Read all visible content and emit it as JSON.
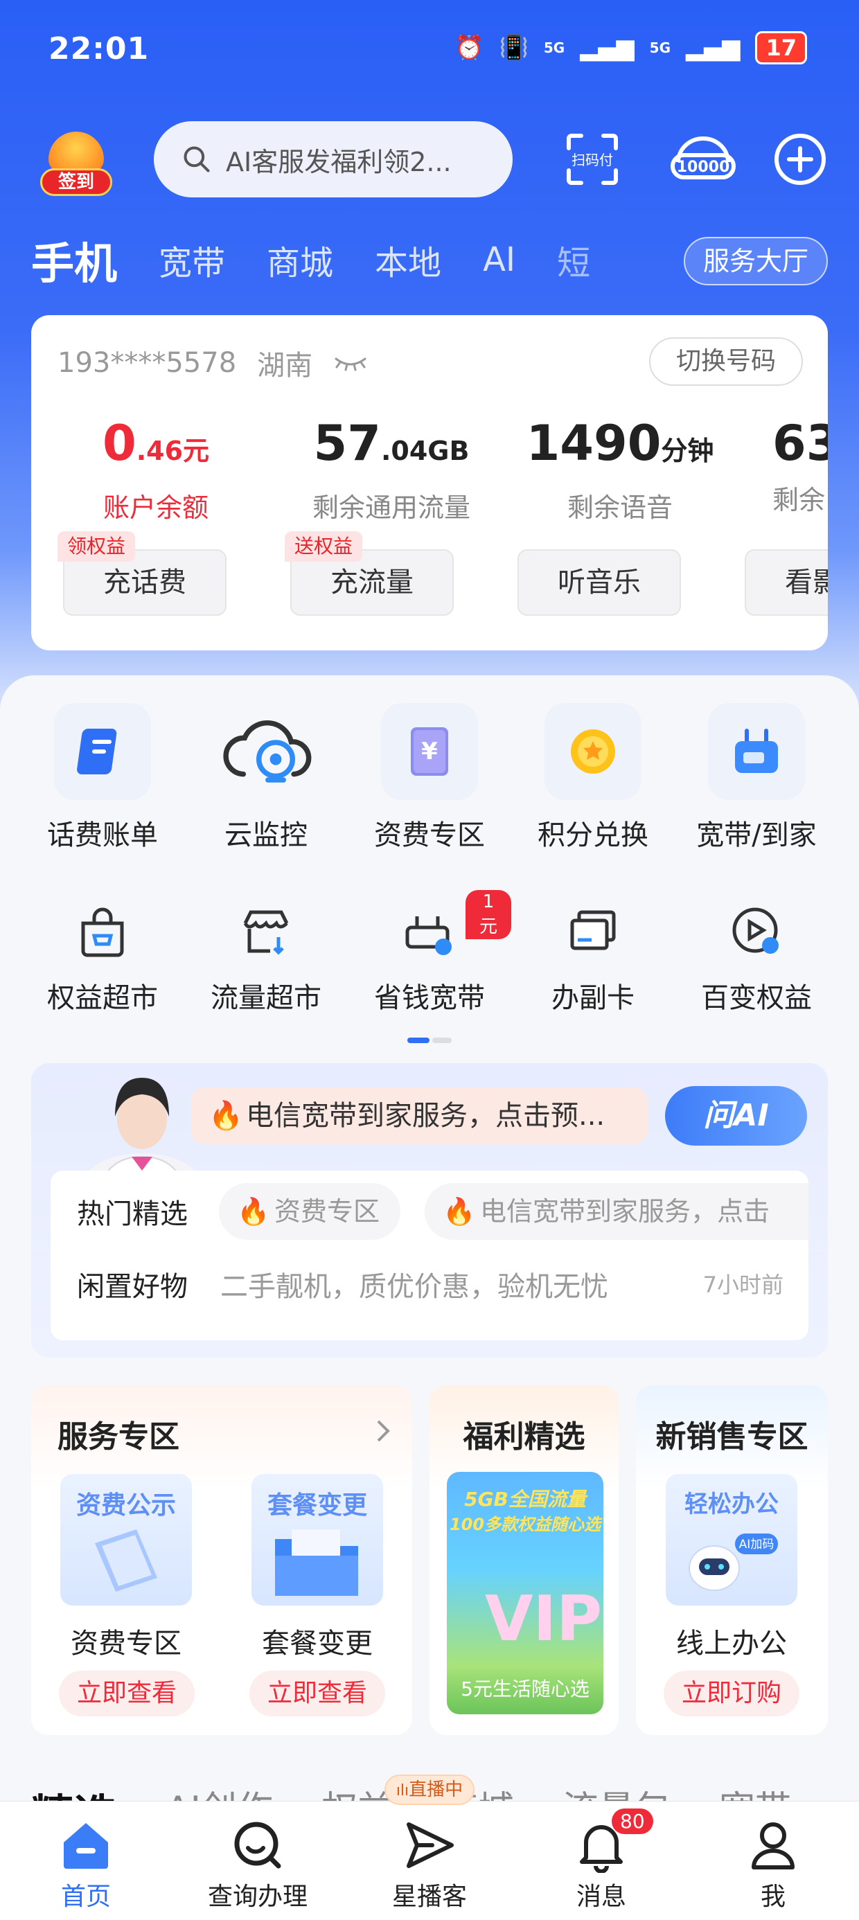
{
  "status_bar": {
    "time": "22:01",
    "battery": "17",
    "signal1": "5G",
    "signal2": "5G"
  },
  "top": {
    "signin_label": "签到",
    "search_placeholder": "AI客服发福利领2...",
    "scan_label": "扫码付",
    "hotline_label": "10000"
  },
  "tabs": [
    "手机",
    "宽带",
    "商城",
    "本地",
    "AI",
    "短"
  ],
  "service_hall": "服务大厅",
  "account": {
    "number": "193****5578",
    "region": "湖南",
    "switch_label": "切换号码",
    "stats": [
      {
        "big": "0.",
        "small": ".46元",
        "bigtext": "0",
        "label": "账户余额"
      },
      {
        "bigtext": "57",
        "small": ".04GB",
        "label": "剩余通用流量"
      },
      {
        "bigtext": "1490",
        "small": "分钟",
        "label": "剩余语音"
      },
      {
        "bigtext": "63",
        "small": "",
        "label": "剩余"
      }
    ],
    "actions": [
      "充话费",
      "充流量",
      "听音乐",
      "看影"
    ],
    "tags": [
      "领权益",
      "送权益"
    ]
  },
  "grid": [
    {
      "label": "话费账单"
    },
    {
      "label": "云监控"
    },
    {
      "label": "资费专区"
    },
    {
      "label": "积分兑换"
    },
    {
      "label": "宽带/到家"
    },
    {
      "label": "权益超市"
    },
    {
      "label": "流量超市"
    },
    {
      "label": "省钱宽带",
      "badge": "1元"
    },
    {
      "label": "办副卡"
    },
    {
      "label": "百变权益"
    }
  ],
  "ai": {
    "bubble": "电信宽带到家服务，点击预...",
    "ask_ai": "问AI",
    "hot_label": "热门精选",
    "chips": [
      "资费专区",
      "电信宽带到家服务，点击"
    ],
    "idle_label": "闲置好物",
    "idle_text": "二手靓机，质优价惠，验机无忧",
    "idle_time": "7小时前"
  },
  "service_zone": {
    "title": "服务专区",
    "items": [
      {
        "pic_title": "资费公示",
        "label": "资费专区",
        "button": "立即查看"
      },
      {
        "pic_title": "套餐变更",
        "label": "套餐变更",
        "button": "立即查看"
      }
    ]
  },
  "welfare": {
    "title": "福利精选",
    "banner_line1": "5GB全国流量",
    "banner_line2": "100多款权益随心选",
    "caption": "5元生活随心选"
  },
  "new_sales": {
    "title": "新销售专区",
    "pic_title": "轻松办公",
    "pic_badge": "AI加码",
    "label": "线上办公",
    "button": "立即订购"
  },
  "bottom_tabs": [
    "精选",
    "AI创作",
    "权益",
    "商城",
    "流量包",
    "宽带"
  ],
  "live_badge": "直播中",
  "nav": [
    {
      "label": "首页"
    },
    {
      "label": "查询办理"
    },
    {
      "label": "星播客"
    },
    {
      "label": "消息",
      "badge": "80"
    },
    {
      "label": "我"
    }
  ],
  "colors": {
    "brand_blue": "#2a5ff6",
    "accent_red": "#ef2b3a"
  }
}
